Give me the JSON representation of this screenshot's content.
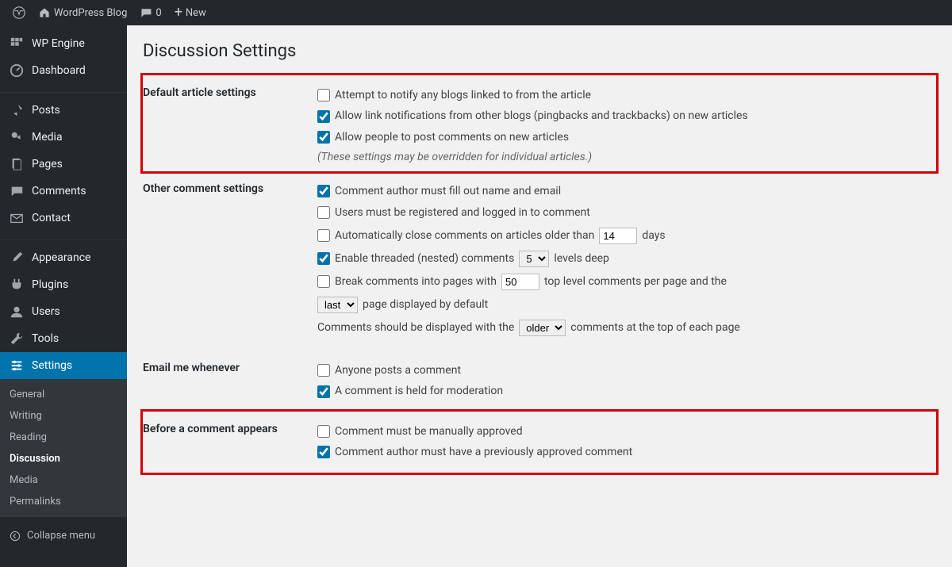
{
  "toolbar": {
    "site_name": "WordPress Blog",
    "comment_count": "0",
    "new_label": "New"
  },
  "menu": {
    "wpengine": "WP Engine",
    "dashboard": "Dashboard",
    "posts": "Posts",
    "media": "Media",
    "pages": "Pages",
    "comments": "Comments",
    "contact": "Contact",
    "appearance": "Appearance",
    "plugins": "Plugins",
    "users": "Users",
    "tools": "Tools",
    "settings": "Settings",
    "collapse": "Collapse menu"
  },
  "submenu": {
    "general": "General",
    "writing": "Writing",
    "reading": "Reading",
    "discussion": "Discussion",
    "media": "Media",
    "permalinks": "Permalinks"
  },
  "page": {
    "title": "Discussion Settings",
    "sections": {
      "default_article": {
        "heading": "Default article settings",
        "opt1": {
          "text": "Attempt to notify any blogs linked to from the article",
          "checked": false
        },
        "opt2": {
          "text": "Allow link notifications from other blogs (pingbacks and trackbacks) on new articles",
          "checked": true
        },
        "opt3": {
          "text": "Allow people to post comments on new articles",
          "checked": true
        },
        "note": "(These settings may be overridden for individual articles.)"
      },
      "other_comment": {
        "heading": "Other comment settings",
        "opt1": {
          "text": "Comment author must fill out name and email",
          "checked": true
        },
        "opt2": {
          "text": "Users must be registered and logged in to comment",
          "checked": false
        },
        "opt3_pre": "Automatically close comments on articles older than",
        "opt3_days": "14",
        "opt3_post": "days",
        "opt3_checked": false,
        "opt4_pre": "Enable threaded (nested) comments",
        "opt4_select": "5",
        "opt4_post": "levels deep",
        "opt4_checked": true,
        "opt5_pre": "Break comments into pages with",
        "opt5_val": "50",
        "opt5_mid": "top level comments per page and the",
        "opt5_checked": false,
        "opt5_page_sel": "last",
        "opt5_page_post": "page displayed by default",
        "opt6_pre": "Comments should be displayed with the",
        "opt6_sel": "older",
        "opt6_post": "comments at the top of each page"
      },
      "email_when": {
        "heading": "Email me whenever",
        "opt1": {
          "text": "Anyone posts a comment",
          "checked": false
        },
        "opt2": {
          "text": "A comment is held for moderation",
          "checked": true
        }
      },
      "before_appear": {
        "heading": "Before a comment appears",
        "opt1": {
          "text": "Comment must be manually approved",
          "checked": false
        },
        "opt2": {
          "text": "Comment author must have a previously approved comment",
          "checked": true
        }
      }
    }
  }
}
